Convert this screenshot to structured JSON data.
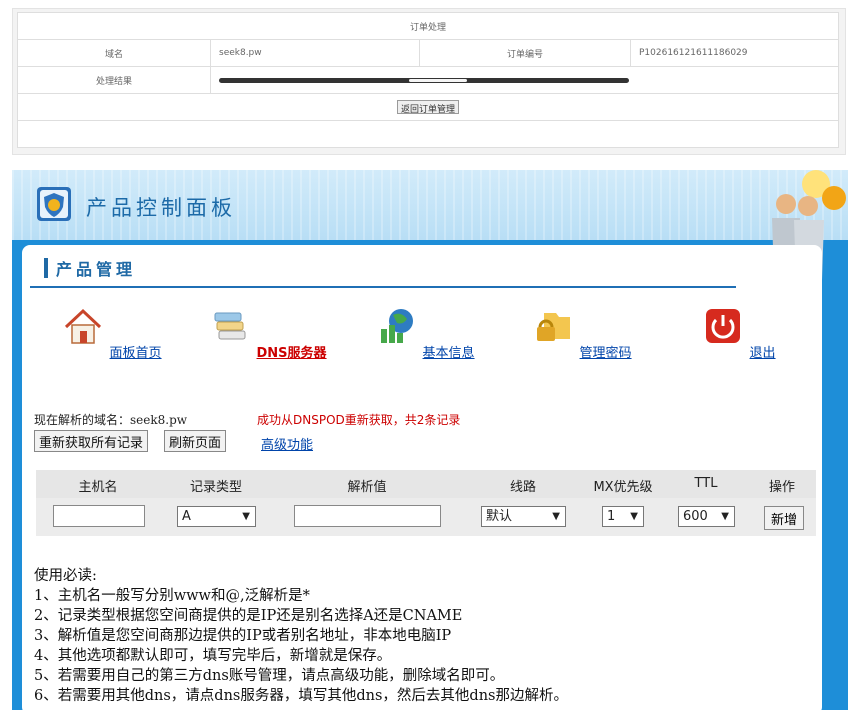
{
  "order": {
    "title": "订单处理",
    "domain_label": "域名",
    "domain_value": "seek8.pw",
    "order_no_label": "订单编号",
    "order_no_value": "P102616121611186029",
    "result_label": "处理结果",
    "back_button": "返回订单管理"
  },
  "panel": {
    "title": "产品控制面板",
    "section_title": "产品管理"
  },
  "nav": [
    {
      "label": "面板首页",
      "icon": "home-icon"
    },
    {
      "label": "DNS服务器",
      "icon": "dns-server-icon"
    },
    {
      "label": "基本信息",
      "icon": "info-chart-icon"
    },
    {
      "label": "管理密码",
      "icon": "lock-folder-icon"
    },
    {
      "label": "退出",
      "icon": "power-icon"
    }
  ],
  "dns": {
    "domain_label": "现在解析的域名：seek8.pw",
    "success_msg": "成功从DNSPOD重新获取，共2条记录",
    "refetch_button": "重新获取所有记录",
    "refresh_button": "刷新页面",
    "advanced_link": "高级功能",
    "headers": [
      "主机名",
      "记录类型",
      "解析值",
      "线路",
      "MX优先级",
      "TTL",
      "操作"
    ],
    "record_type": "A",
    "line": "默认",
    "mx": "1",
    "ttl": "600",
    "add_button": "新增"
  },
  "notes": [
    "使用必读:",
    "1、主机名一般写分别www和@,泛解析是*",
    "2、记录类型根据您空间商提供的是IP还是别名选择A还是CNAME",
    "3、解析值是您空间商那边提供的IP或者别名地址，非本地电脑IP",
    "4、其他选项都默认即可，填写完毕后，新增就是保存。",
    "5、若需要用自己的第三方dns账号管理，请点高级功能，删除域名即可。",
    "6、若需要用其他dns，请点dns服务器，填写其他dns，然后去其他dns那边解析。"
  ],
  "colors": {
    "panel_blue": "#1e8ed8",
    "title_blue": "#1c6aa8",
    "link_blue": "#0044aa",
    "active_red": "#cc0000"
  }
}
